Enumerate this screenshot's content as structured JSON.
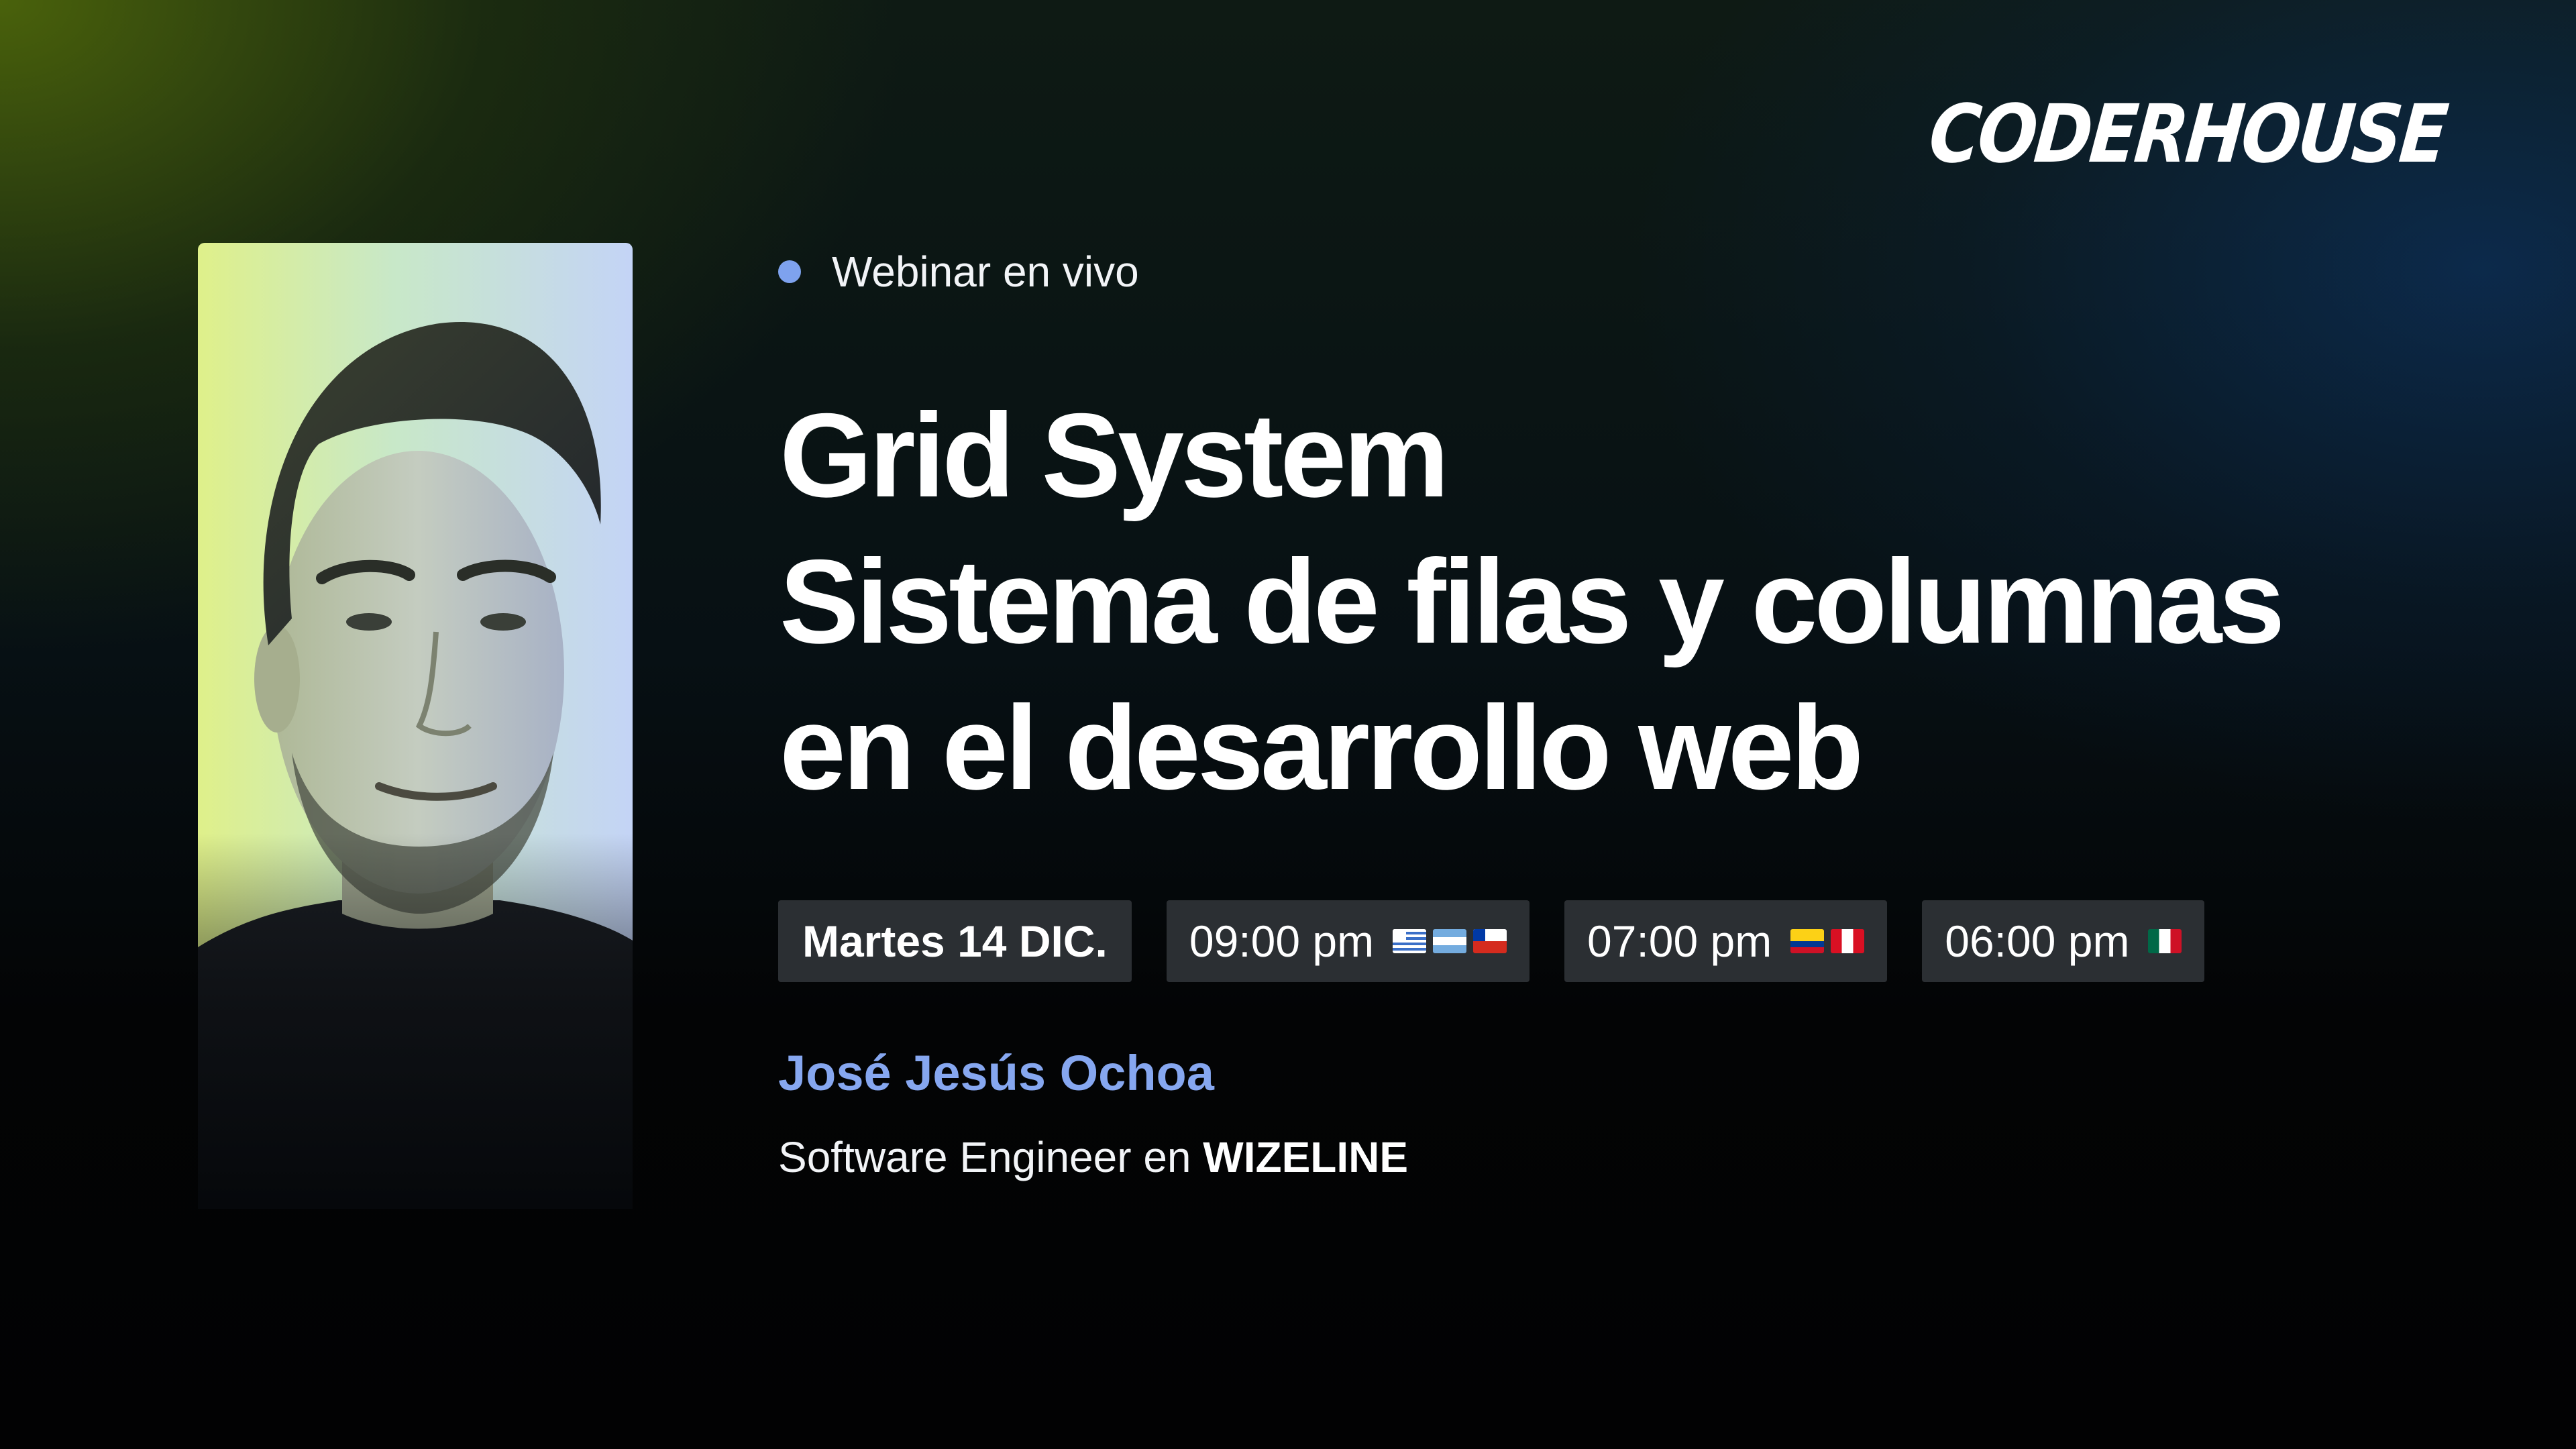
{
  "brand": {
    "logo_text": "CODERHOUSE"
  },
  "event": {
    "badge": "Webinar en vivo",
    "title_lines": [
      "Grid System",
      "Sistema de filas y columnas",
      "en el desarrollo web"
    ]
  },
  "schedule": {
    "date": "Martes 14 DIC.",
    "times": [
      {
        "time": "09:00 pm",
        "flags": [
          "uruguay-flag-icon",
          "argentina-flag-icon",
          "chile-flag-icon"
        ]
      },
      {
        "time": "07:00 pm",
        "flags": [
          "colombia-flag-icon",
          "peru-flag-icon"
        ]
      },
      {
        "time": "06:00 pm",
        "flags": [
          "mexico-flag-icon"
        ]
      }
    ]
  },
  "speaker": {
    "name": "José Jesús Ochoa",
    "role_prefix": "Software Engineer en",
    "company": "WIZELINE",
    "photo": "speaker-portrait"
  },
  "colors": {
    "accent": "#86a7f0",
    "live_dot": "#7ea2ee",
    "chip_background": "#2b2f33",
    "text": "#ffffff"
  }
}
